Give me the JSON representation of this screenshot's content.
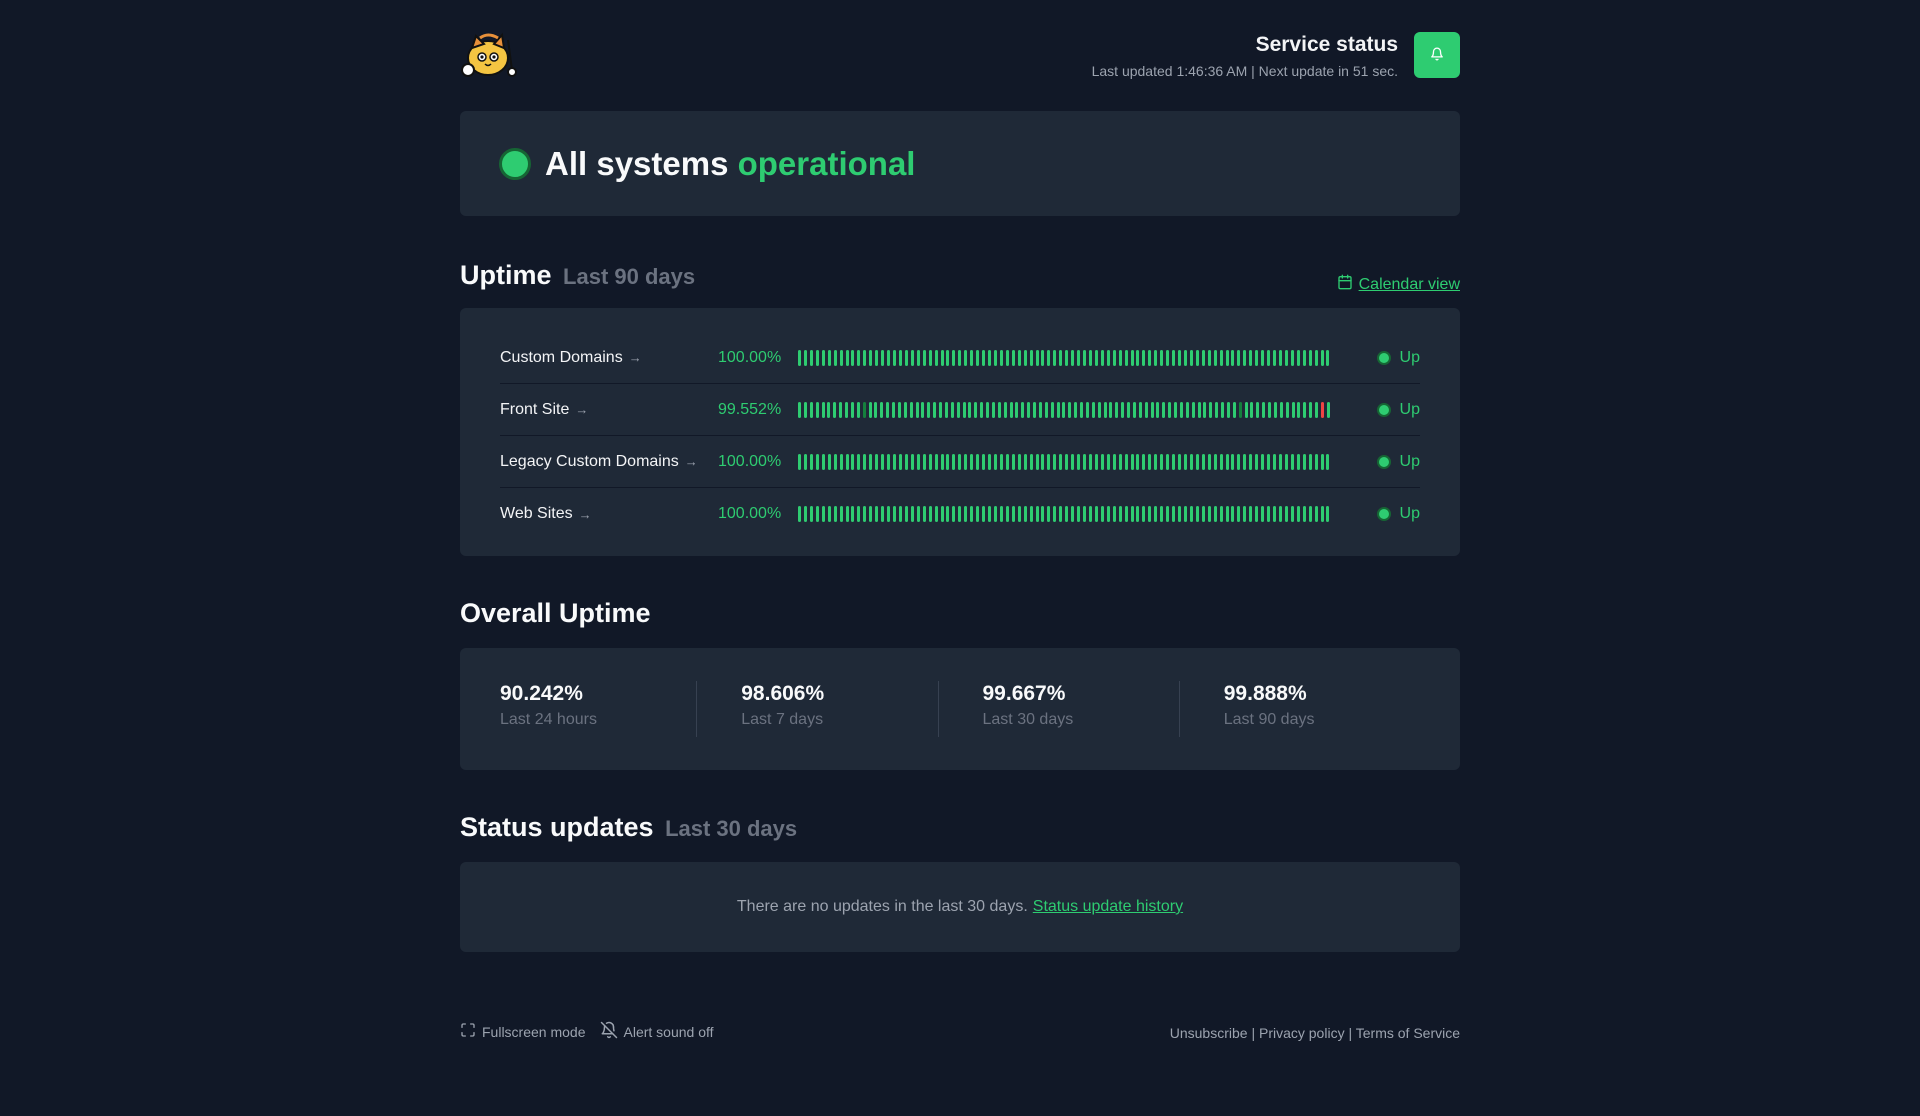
{
  "header": {
    "title": "Service status",
    "subtitle": "Last updated 1:46:36 AM | Next update in 51 sec."
  },
  "hero": {
    "text": "All systems",
    "accent": "operational"
  },
  "uptime": {
    "title": "Uptime",
    "subtitle": "Last 90 days",
    "calendar_link": "Calendar view",
    "monitors": [
      {
        "name": "Custom Domains",
        "percent": "100.00%",
        "status": "Up",
        "bars": "gggggggggggggggggggggggggggggggggggggggggggggggggggggggggggggggggggggggggggggggggggggggggg"
      },
      {
        "name": "Front Site",
        "percent": "99.552%",
        "status": "Up",
        "bars": "gggggggggggdgggggggggggggggggggggggggggggggggggggggggggggggggggggggggggggggdgggggggggggggrg"
      },
      {
        "name": "Legacy Custom Domains",
        "percent": "100.00%",
        "status": "Up",
        "bars": "gggggggggggggggggggggggggggggggggggggggggggggggggggggggggggggggggggggggggggggggggggggggggg"
      },
      {
        "name": "Web Sites",
        "percent": "100.00%",
        "status": "Up",
        "bars": "gggggggggggggggggggggggggggggggggggggggggggggggggggggggggggggggggggggggggggggggggggggggggg"
      }
    ]
  },
  "overall": {
    "title": "Overall Uptime",
    "stats": [
      {
        "value": "90.242%",
        "label": "Last 24 hours"
      },
      {
        "value": "98.606%",
        "label": "Last 7 days"
      },
      {
        "value": "99.667%",
        "label": "Last 30 days"
      },
      {
        "value": "99.888%",
        "label": "Last 90 days"
      }
    ]
  },
  "status_updates": {
    "title": "Status updates",
    "subtitle": "Last 30 days",
    "empty_text": "There are no updates in the last 30 days.",
    "history_link": "Status update history"
  },
  "footer": {
    "fullscreen": "Fullscreen mode",
    "alert_sound": "Alert sound off",
    "unsubscribe": "Unsubscribe",
    "privacy": "Privacy policy",
    "terms": "Terms of Service",
    "separator": " | "
  },
  "colors": {
    "background": "#111827",
    "card": "#1f2937",
    "accent": "#2ecc71",
    "degraded": "#15803d",
    "down": "#ef4444"
  },
  "icons": {
    "logo": "cat-mascot-logo",
    "bell": "bell-icon",
    "calendar": "calendar-icon",
    "fullscreen": "fullscreen-icon",
    "alert_off": "bell-off-icon"
  }
}
